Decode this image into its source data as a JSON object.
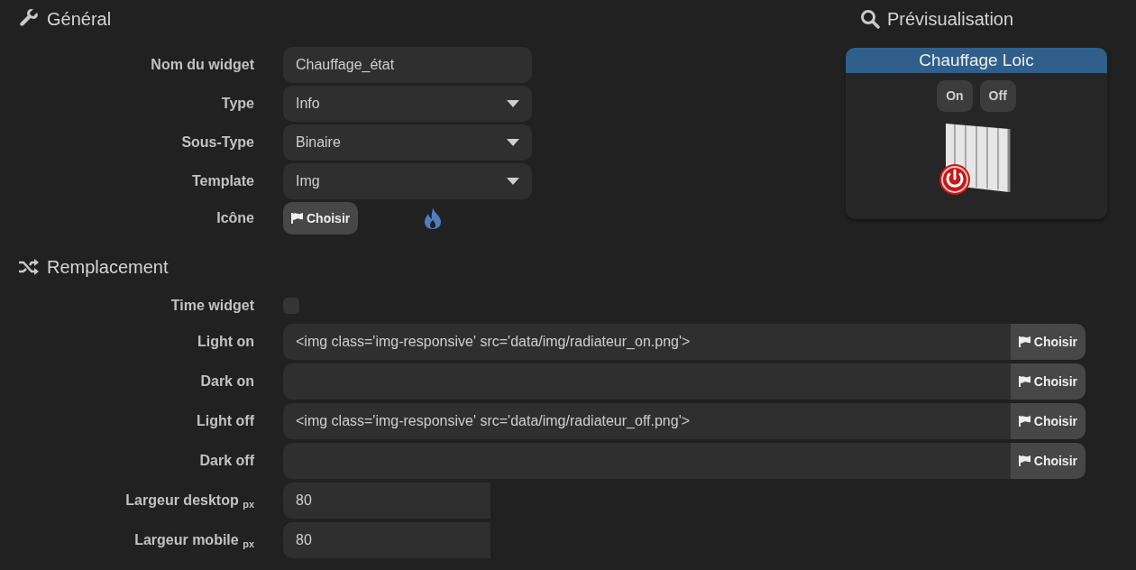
{
  "general": {
    "title": "Général",
    "fields": [
      {
        "kind": "text",
        "label": "Nom du widget",
        "value": "Chauffage_état"
      },
      {
        "kind": "select",
        "label": "Type",
        "value": "Info"
      },
      {
        "kind": "select",
        "label": "Sous-Type",
        "value": "Binaire"
      },
      {
        "kind": "select",
        "label": "Template",
        "value": "Img"
      },
      {
        "kind": "icon",
        "label": "Icône",
        "button": "Choisir"
      }
    ]
  },
  "preview": {
    "title": "Prévisualisation",
    "widget_title": "Chauffage Loic",
    "buttons": [
      "On",
      "Off"
    ]
  },
  "replacement": {
    "title": "Remplacement",
    "fields": [
      {
        "kind": "checkbox",
        "label": "Time widget",
        "checked": false
      },
      {
        "kind": "image",
        "label": "Light on",
        "value": "<img class='img-responsive' src='data/img/radiateur_on.png'>",
        "button": "Choisir"
      },
      {
        "kind": "image",
        "label": "Dark on",
        "button": "Choisir"
      },
      {
        "kind": "image",
        "label": "Light off",
        "value": "<img class='img-responsive' src='data/img/radiateur_off.png'>",
        "button": "Choisir"
      },
      {
        "kind": "image",
        "label": "Dark off",
        "button": "Choisir"
      },
      {
        "kind": "number",
        "label": "Largeur desktop $_{px}$",
        "value": "80"
      },
      {
        "kind": "number",
        "label": "Largeur mobile $_{px}$",
        "value": "80"
      }
    ]
  }
}
